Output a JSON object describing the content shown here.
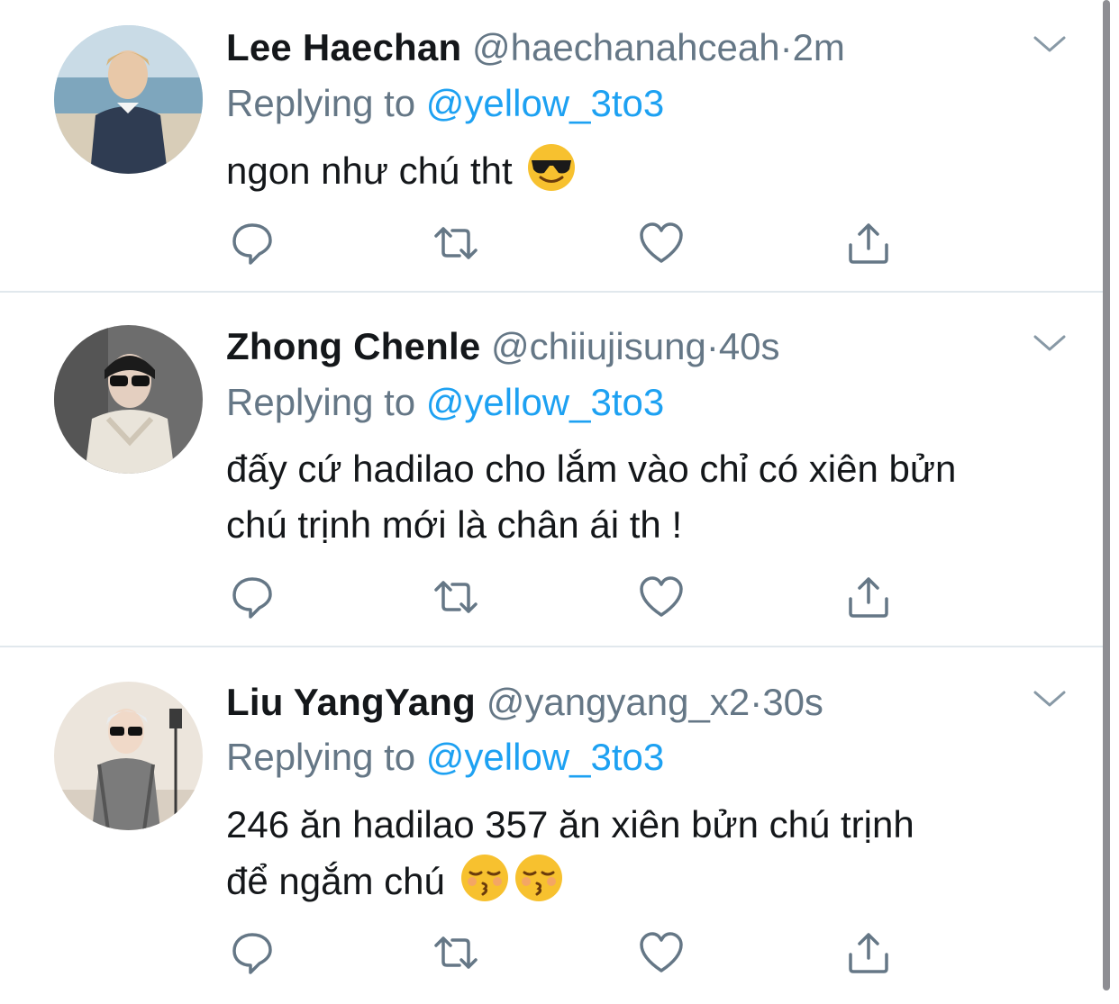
{
  "tweets": [
    {
      "name": "Lee Haechan",
      "handle": "@haechanahceah",
      "separator": "·",
      "time": "2m",
      "reply_prefix": "Replying to",
      "reply_to": "@yellow_3to3",
      "text": "ngon như chú tht",
      "emojis": [
        "smiling-face-with-sunglasses"
      ]
    },
    {
      "name": "Zhong Chenle",
      "handle": "@chiiujisung",
      "separator": "·",
      "time": "40s",
      "reply_prefix": "Replying to",
      "reply_to": "@yellow_3to3",
      "text": "đấy cứ hadilao cho lắm vào chỉ có xiên bửn\nchú trịnh mới là chân ái th !",
      "emojis": []
    },
    {
      "name": "Liu YangYang",
      "handle": "@yangyang_x2",
      "separator": "·",
      "time": "30s",
      "reply_prefix": "Replying to",
      "reply_to": "@yellow_3to3",
      "text": "246 ăn hadilao 357 ăn xiên bửn chú trịnh\nđể ngắm chú",
      "emojis": [
        "kissing-face-with-closed-eyes",
        "kissing-face-with-closed-eyes"
      ]
    }
  ],
  "icons": [
    "reply-icon",
    "retweet-icon",
    "like-icon",
    "share-icon",
    "chevron-down-icon"
  ],
  "colors": {
    "mention": "#1da1f2",
    "secondary_text": "#657786",
    "primary_text": "#14171a",
    "divider": "#e1e8ed"
  }
}
